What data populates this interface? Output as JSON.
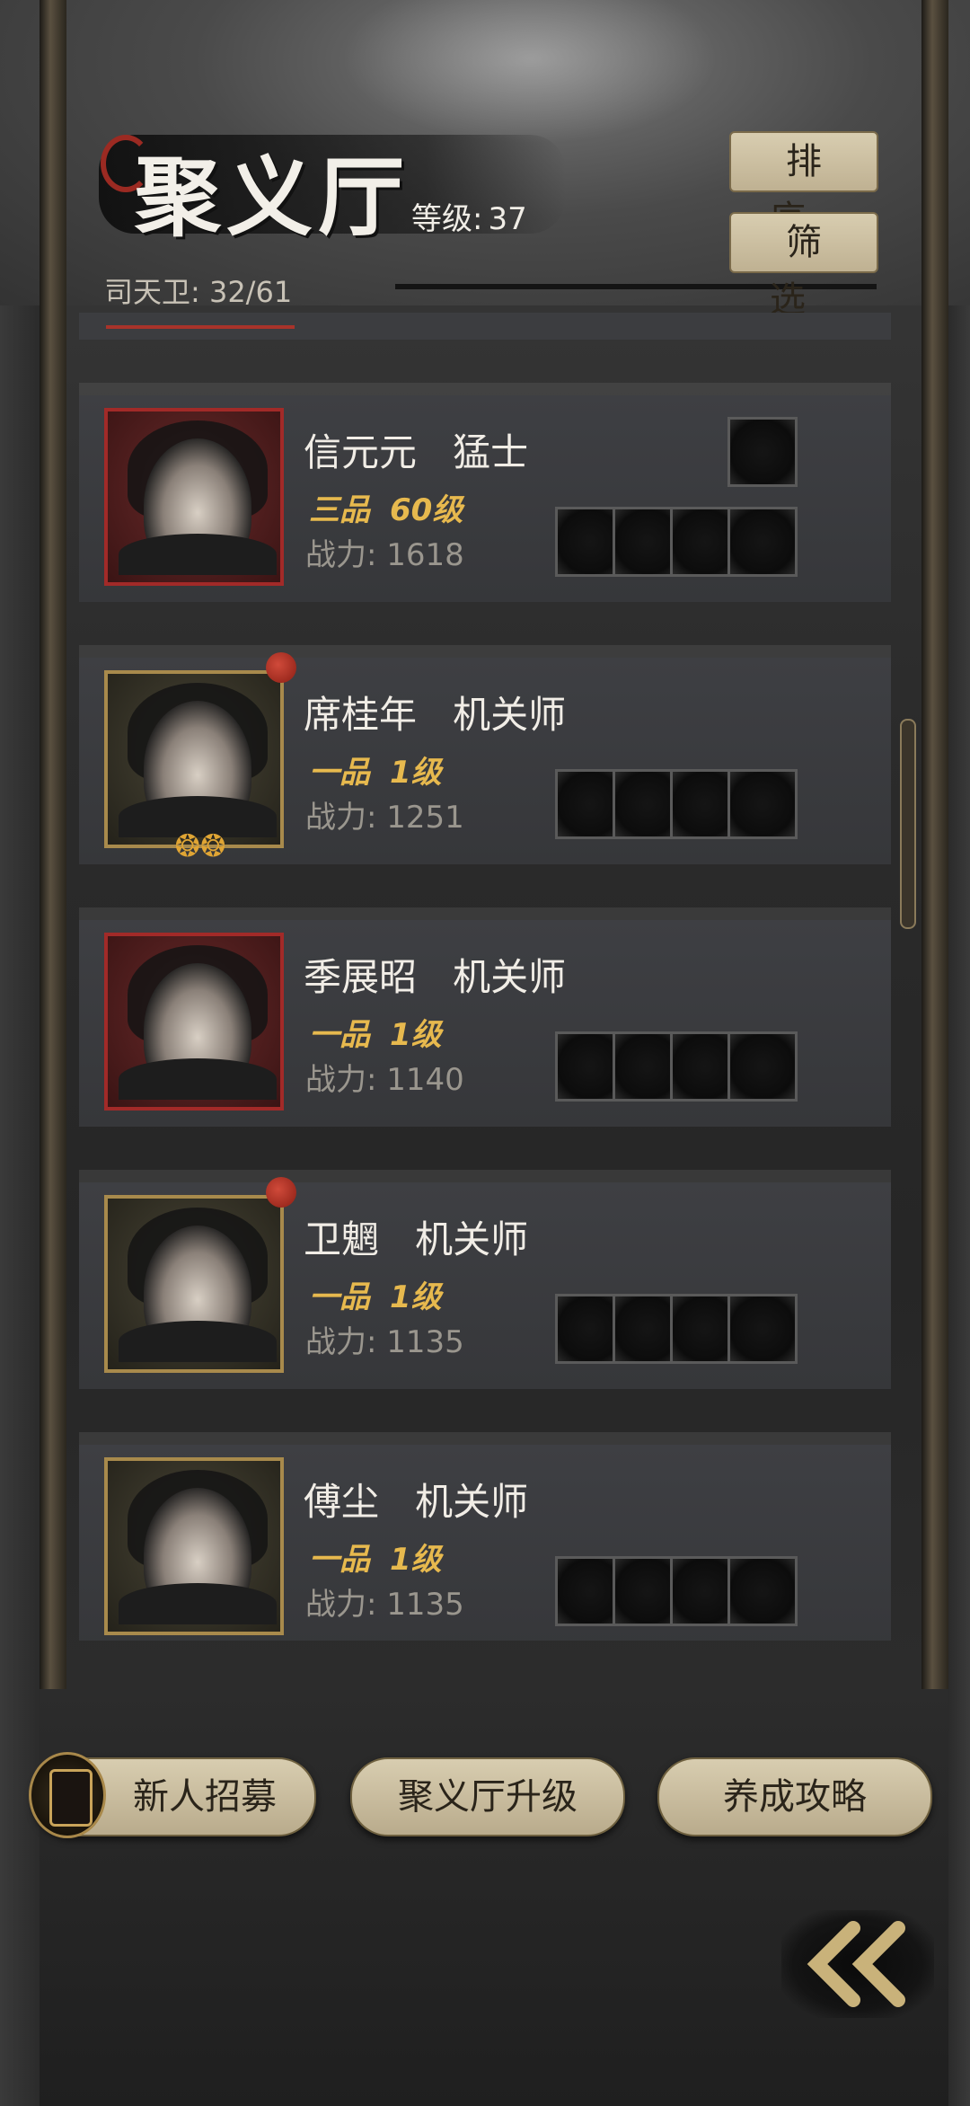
{
  "header": {
    "title": "聚义厅",
    "level_label": "等级:",
    "level_value": "37",
    "guard_count": "司天卫: 32/61",
    "sort_label": "排序",
    "filter_label": "筛选"
  },
  "characters": [
    {
      "name": "信元元",
      "role": "猛士",
      "grade": "三品",
      "level": "60级",
      "power": "战力: 1618",
      "frame": "red",
      "red_dot": false
    },
    {
      "name": "席桂年",
      "role": "机关师",
      "grade": "一品",
      "level": "1级",
      "power": "战力: 1251",
      "frame": "gold",
      "red_dot": true
    },
    {
      "name": "季展昭",
      "role": "机关师",
      "grade": "一品",
      "level": "1级",
      "power": "战力: 1140",
      "frame": "red",
      "red_dot": false
    },
    {
      "name": "卫魍",
      "role": "机关师",
      "grade": "一品",
      "level": "1级",
      "power": "战力: 1135",
      "frame": "gold",
      "red_dot": true
    },
    {
      "name": "傅尘",
      "role": "机关师",
      "grade": "一品",
      "level": "1级",
      "power": "战力: 1135",
      "frame": "gold",
      "red_dot": false
    }
  ],
  "bottom": {
    "recruit_label": "新人招募",
    "upgrade_label": "聚义厅升级",
    "guide_label": "养成攻略"
  },
  "colors": {
    "accent_gold": "#e7b94e",
    "frame_red": "#a22a28",
    "frame_gold": "#a88a4c",
    "button_bg": "#d8cdb0"
  },
  "icons": {
    "back": "double-chevron-left-icon",
    "recruit": "recruit-token-icon"
  }
}
